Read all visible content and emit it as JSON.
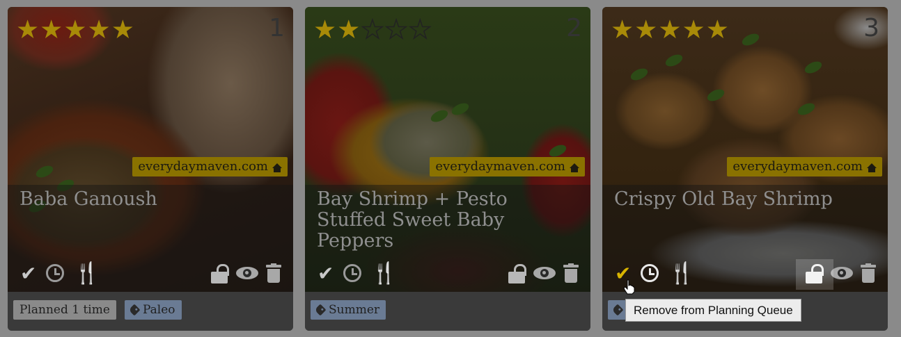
{
  "cards": [
    {
      "rank": "1",
      "rating": 5,
      "source": "everydaymaven.com",
      "title": "Baba Ganoush",
      "planned": "Planned 1 time",
      "tags": [
        "Paleo"
      ],
      "planned_state": "checked"
    },
    {
      "rank": "2",
      "rating": 2,
      "source": "everydaymaven.com",
      "title": "Bay Shrimp + Pesto Stuffed Sweet Baby Peppers",
      "tags": [
        "Summer"
      ],
      "planned_state": "checked"
    },
    {
      "rank": "3",
      "rating": 5,
      "source": "everydaymaven.com",
      "title": "Crispy Old Bay Shrimp",
      "tags": [
        ""
      ],
      "planned_state": "active-hover"
    }
  ],
  "tooltip": "Remove from Planning Queue",
  "icons": {
    "star": "star-icon",
    "home": "home-icon",
    "check": "checkmark-icon",
    "clock": "clock-icon",
    "utensils": "fork-knife-icon",
    "lock": "unlock-icon",
    "eye": "eye-icon",
    "trash": "trash-icon",
    "tag": "tag-icon",
    "cursor": "hand-pointer-icon"
  },
  "colors": {
    "star": "#a88a08",
    "source_badge": "#8a7200",
    "check_active": "#d8b400",
    "tag_chip": "#6a7b94",
    "planned_chip": "#8a8a8a"
  }
}
